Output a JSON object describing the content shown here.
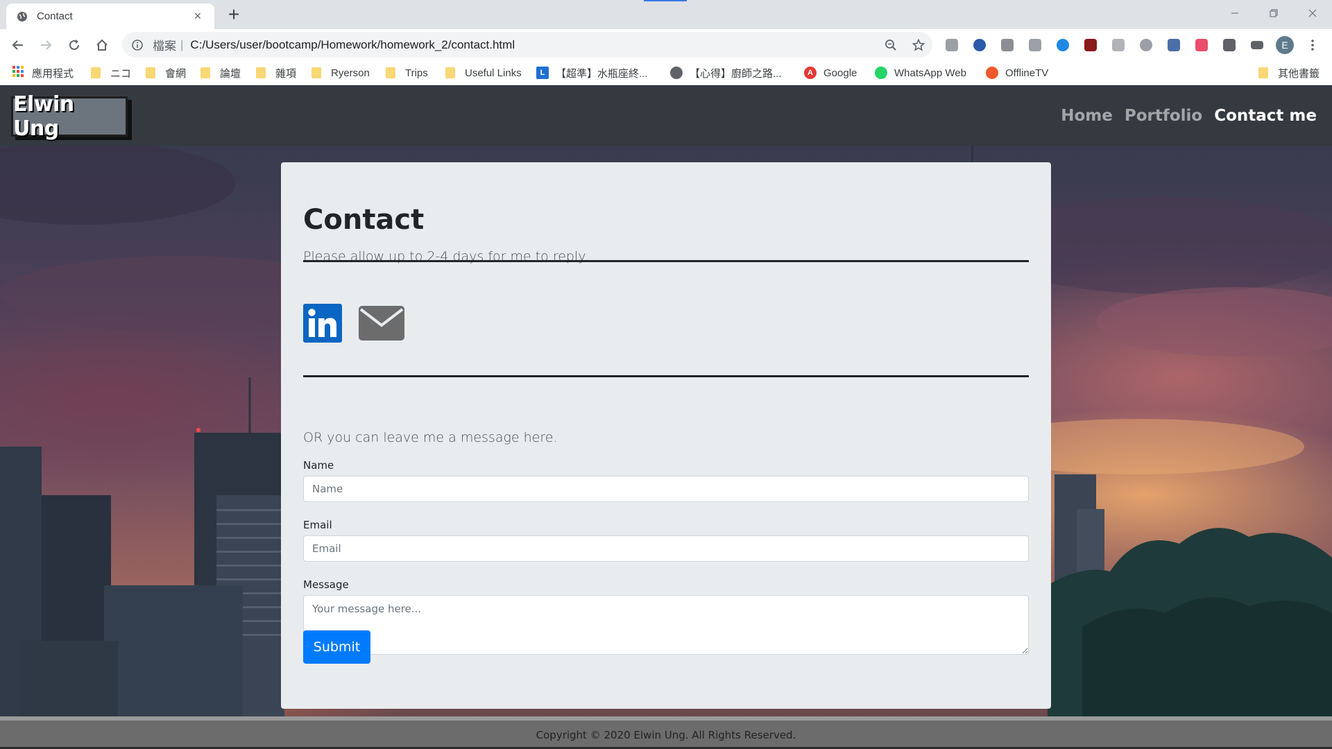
{
  "browser": {
    "tab_title": "Contact",
    "tab_close": "×",
    "new_tab": "+",
    "scheme_label": "檔案",
    "url_separator": "|",
    "url": "C:/Users/user/bootcamp/Homework/homework_2/contact.html",
    "profile_initial": "E",
    "accent": "#3b78e7"
  },
  "bookmarks": {
    "apps": "應用程式",
    "items": [
      "ニコ",
      "會網",
      "論壇",
      "雜項",
      "Ryerson",
      "Trips",
      "Useful Links",
      "【超準】水瓶座終...",
      "【心得】廚師之路...",
      "Google",
      "WhatsApp Web",
      "OfflineTV"
    ],
    "other": "其他書籤"
  },
  "site": {
    "brand": "Elwin Ung",
    "nav": {
      "home": "Home",
      "portfolio": "Portfolio",
      "contact": "Contact me"
    }
  },
  "contact": {
    "title": "Contact",
    "lead": "Please allow up to 2-4 days for me to reply.",
    "alt_text": "OR you can leave me a message here.",
    "social": [
      "linkedin-icon",
      "envelope-icon"
    ],
    "linkedin_color": "#0a66c2",
    "form": {
      "name_label": "Name",
      "name_placeholder": "Name",
      "email_label": "Email",
      "email_placeholder": "Email",
      "message_label": "Message",
      "message_placeholder": "Your message here...",
      "submit_label": "Submit",
      "submit_color": "#007bff"
    }
  },
  "footer": {
    "copyright": "Copyright © 2020 Elwin Ung. All Rights Reserved."
  }
}
